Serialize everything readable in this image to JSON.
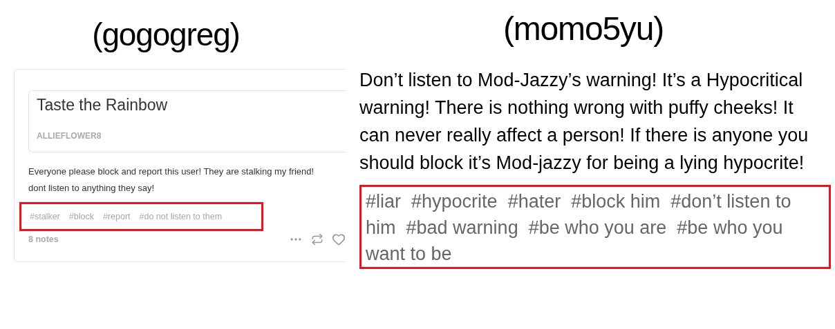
{
  "left": {
    "title": "(gogogreg)",
    "post": {
      "quote_title": "Taste the Rainbow",
      "quote_author": "ALLIEFLOWER8",
      "body": "Everyone please block and report this user! They are stalking my friend! dont listen to anything they say!",
      "tags_highlighted": true,
      "tags": [
        "#stalker",
        "#block",
        "#report",
        "#do not listen to them"
      ],
      "notes": "8 notes"
    }
  },
  "right": {
    "title": "(momo5yu)",
    "body": "Don’t listen to Mod-Jazzy’s warning! It’s a Hypocritical warning! There is nothing wrong with puffy cheeks! It can never really affect a person! If there is anyone you should block it’s Mod-jazzy for being a lying hypocrite!",
    "tags_highlighted": true,
    "tags": [
      "#liar",
      "#hypocrite",
      "#hater",
      "#block him",
      "#don’t listen to him",
      "#bad warning",
      "#be who you are",
      "#be who you want to be"
    ]
  }
}
